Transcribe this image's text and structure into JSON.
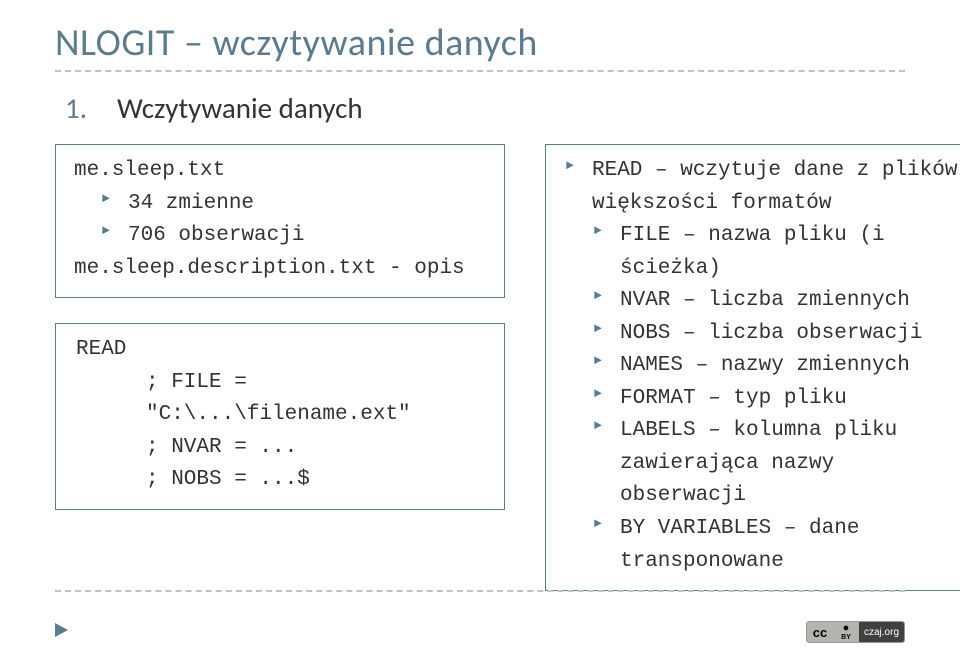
{
  "title": "NLOGIT – wczytywanie danych",
  "subtitle": {
    "num": "1.",
    "text": "Wczytywanie danych"
  },
  "left_box": {
    "line1": "me.sleep.txt",
    "line2": "34 zmienne",
    "line3": "706 obserwacji",
    "line4": "me.sleep.description.txt - opis"
  },
  "right_box": {
    "r1a": "READ – wczytuje dane z plików",
    "r1b": "większości formatów",
    "r2a": "FILE – nazwa pliku (i",
    "r2b": "ścieżka)",
    "r3": "NVAR – liczba zmiennych",
    "r4": "NOBS – liczba obserwacji",
    "r5": "NAMES – nazwy zmiennych",
    "r6": "FORMAT – typ pliku",
    "r7a": "LABELS – kolumna pliku",
    "r7b": "zawierająca nazwy",
    "r7c": "obserwacji",
    "r8a": "BY VARIABLES – dane",
    "r8b": "transponowane"
  },
  "code_box": {
    "c1": "READ",
    "c2": "; FILE = \"C:\\...\\filename.ext\"",
    "c3": "; NVAR = ...",
    "c4": "; NOBS = ...$"
  },
  "cc": {
    "cc": "cc",
    "by": "BY",
    "domain": "czaj.org"
  }
}
